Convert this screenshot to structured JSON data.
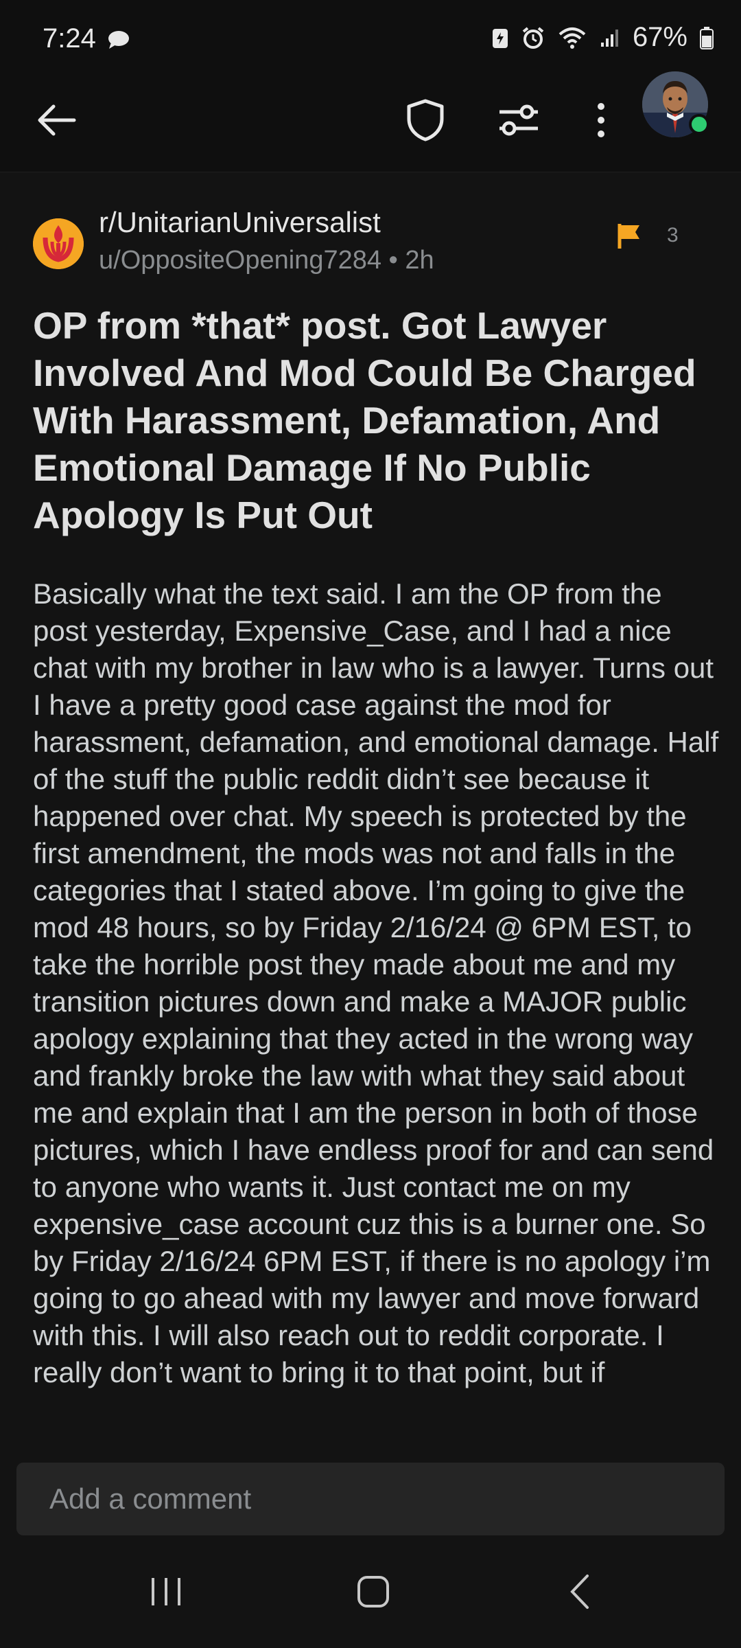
{
  "status_bar": {
    "time": "7:24",
    "battery_percent": "67%",
    "icons": [
      "chat-notification-icon",
      "battery-saver-icon",
      "alarm-icon",
      "wifi-icon",
      "signal-icon",
      "battery-icon"
    ]
  },
  "app_bar": {
    "icons": [
      "back-arrow-icon",
      "shield-icon",
      "filter-sliders-icon",
      "more-vert-icon",
      "user-avatar"
    ],
    "avatar_online": true
  },
  "post": {
    "subreddit": "r/UnitarianUniversalist",
    "meta": "u/OppositeOpening7284 • 2h",
    "flag_count": "3",
    "title": "OP from *that* post. Got Lawyer Involved And Mod Could Be Charged With Harassment, Defamation, And Emotional Damage If No Public Apology Is Put Out",
    "body": "Basically what the text said.  I am the OP from the post yesterday, Expensive_Case, and I had a nice chat with my brother in law who is a lawyer. Turns out I have a pretty good case against the mod for harassment, defamation, and emotional damage. Half of the stuff the public reddit didn’t see because it happened over chat. My speech is protected by the first amendment, the mods was not and falls in the categories that I stated above. I’m going to give the mod 48 hours, so by Friday 2/16/24 @ 6PM EST, to take the horrible post they made about me and my transition pictures down and make a MAJOR public apology explaining that they acted in the wrong way and frankly broke the law with what they said about me and explain that I am the person in both of those pictures, which I have endless proof for and can send to anyone who wants it. Just contact me on my expensive_case account cuz this is a burner one. So by Friday 2/16/24 6PM EST, if there is no apology i’m going to go ahead with my lawyer and move forward with this. I will also reach out to reddit corporate. I really don’t want to bring it to that point, but if"
  },
  "comment": {
    "placeholder": "Add a comment"
  },
  "colors": {
    "background": "#131313",
    "flag": "#f5a623",
    "subreddit_icon": "#f5a623",
    "online_dot": "#2ecc71"
  }
}
